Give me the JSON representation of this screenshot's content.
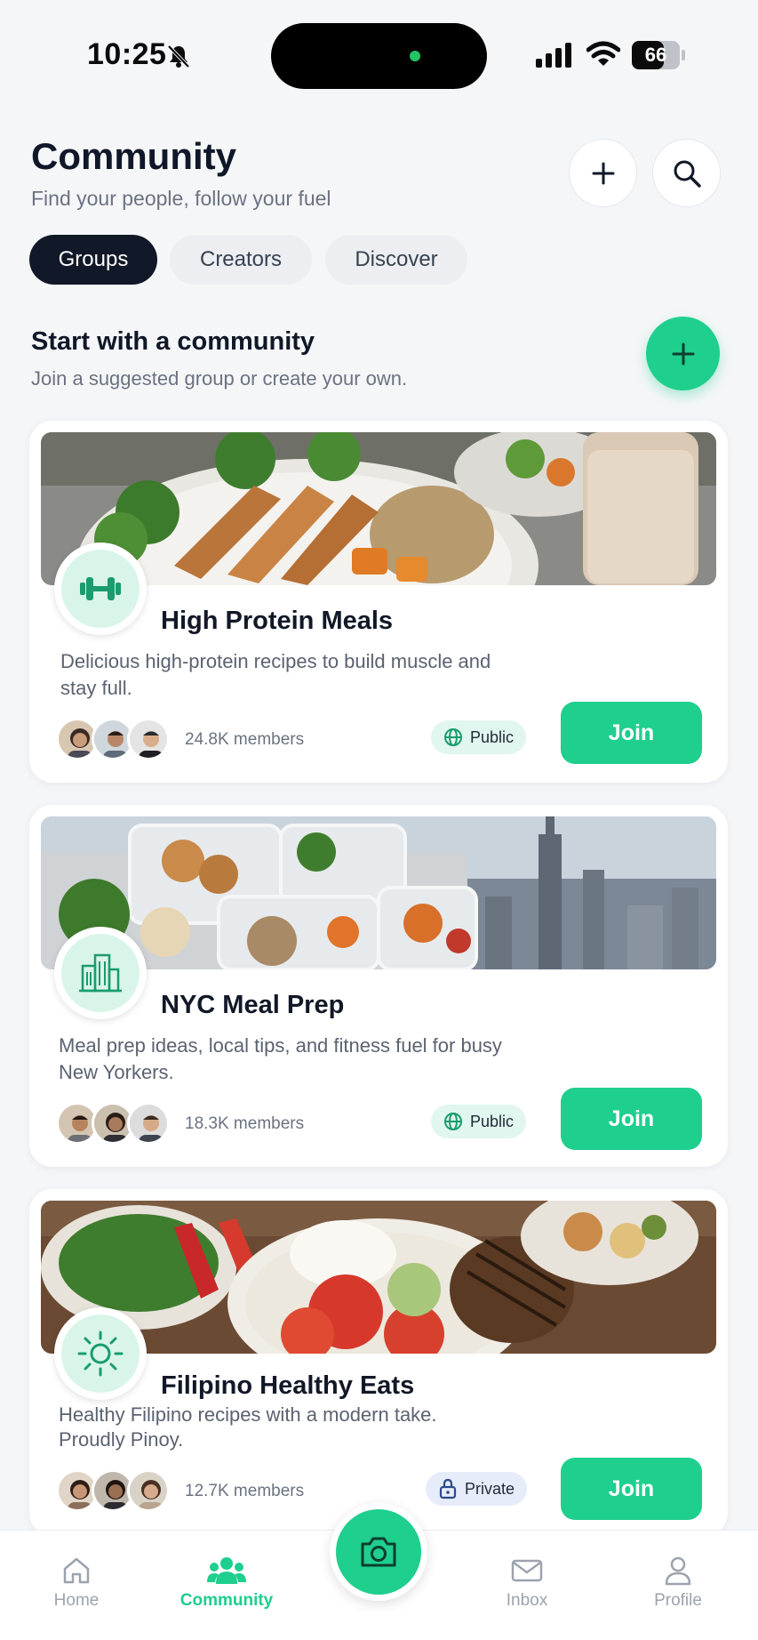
{
  "status_bar": {
    "time": "10:25",
    "battery": "66"
  },
  "header": {
    "title": "Community",
    "subtitle": "Find your people, follow your fuel"
  },
  "tabs": [
    {
      "label": "Groups",
      "active": true
    },
    {
      "label": "Creators",
      "active": false
    },
    {
      "label": "Discover",
      "active": false
    }
  ],
  "section": {
    "title": "Start with a community",
    "subtitle": "Join a suggested group or create your own."
  },
  "groups": [
    {
      "name": "High Protein Meals",
      "description": "Delicious high-protein recipes to build muscle and stay full.",
      "members": "24.8K members",
      "visibility": "Public",
      "icon": "dumbbell-icon",
      "join_label": "Join"
    },
    {
      "name": "NYC Meal Prep",
      "description": "Meal prep ideas, local tips, and fitness fuel for busy New Yorkers.",
      "members": "18.3K members",
      "visibility": "Public",
      "icon": "buildings-icon",
      "join_label": "Join"
    },
    {
      "name": "Filipino Healthy Eats",
      "description": "Healthy Filipino recipes with a modern take. Proudly Pinoy.",
      "members": "12.7K members",
      "visibility": "Private",
      "icon": "sun-icon",
      "join_label": "Join"
    }
  ],
  "nav": [
    {
      "label": "Home",
      "icon": "home-icon",
      "active": false
    },
    {
      "label": "Community",
      "icon": "people-icon",
      "active": true
    },
    {
      "label": "Inbox",
      "icon": "mail-icon",
      "active": false
    },
    {
      "label": "Profile",
      "icon": "person-icon",
      "active": false
    }
  ],
  "colors": {
    "accent": "#1ecf8e",
    "dark": "#111827"
  }
}
